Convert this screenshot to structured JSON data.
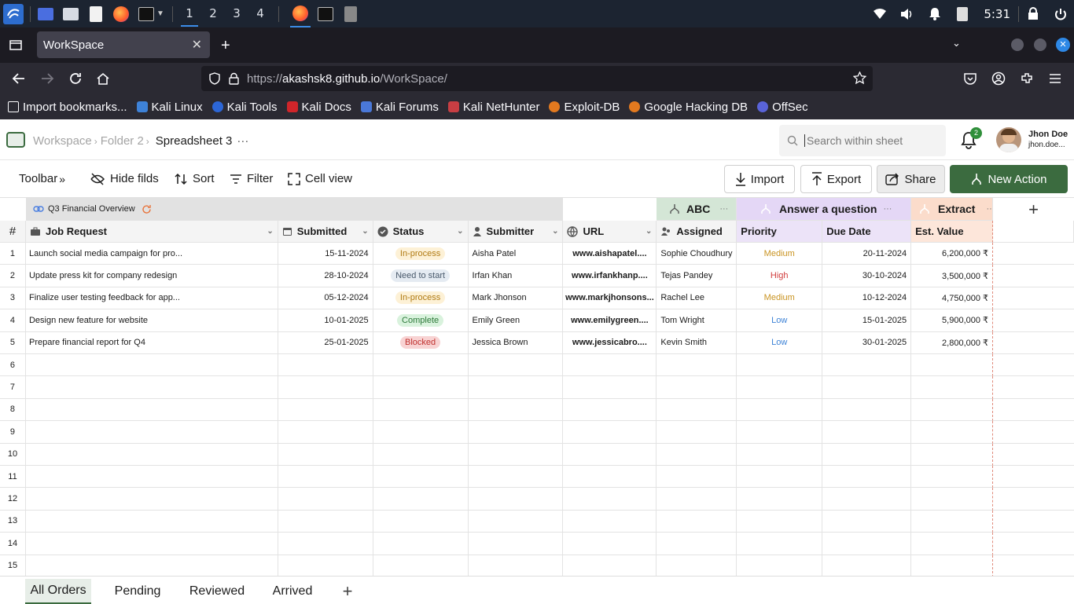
{
  "os": {
    "workspaces": [
      "1",
      "2",
      "3",
      "4"
    ],
    "clock": "5:31"
  },
  "browser": {
    "tab_title": "WorkSpace",
    "url_prefix": "https://",
    "url_host": "akashsk8.github.io",
    "url_path": "/WorkSpace/",
    "bookmarks": [
      "Import bookmarks...",
      "Kali Linux",
      "Kali Tools",
      "Kali Docs",
      "Kali Forums",
      "Kali NetHunter",
      "Exploit-DB",
      "Google Hacking DB",
      "OffSec"
    ]
  },
  "app": {
    "breadcrumb": {
      "root": "Workspace",
      "folder": "Folder 2",
      "sheet": "Spreadsheet 3",
      "more": "···"
    },
    "search_placeholder": "Search within sheet",
    "notifications": "2",
    "user": {
      "name": "Jhon Doe",
      "email": "jhon.doe..."
    }
  },
  "toolbar": {
    "toolbar": "Toolbar",
    "hide": "Hide filds",
    "sort": "Sort",
    "filter": "Filter",
    "cellview": "Cell view",
    "import": "Import",
    "export": "Export",
    "share": "Share",
    "new_action": "New Action"
  },
  "groups": {
    "overview": "Q3 Financial Overview",
    "abc": "ABC",
    "answer": "Answer a question",
    "extract": "Extract",
    "more": "···",
    "add": "+"
  },
  "columns": [
    "#",
    "Job Request",
    "Submitted",
    "Status",
    "Submitter",
    "URL",
    "Assigned",
    "Priority",
    "Due Date",
    "Est. Value"
  ],
  "rows": [
    {
      "n": "1",
      "job": "Launch social media campaign for pro...",
      "submitted": "15-11-2024",
      "status": "In-process",
      "submitter": "Aisha Patel",
      "url": "www.aishapatel....",
      "assigned": "Sophie Choudhury",
      "priority": "Medium",
      "due": "20-11-2024",
      "value": "6,200,000 ₹"
    },
    {
      "n": "2",
      "job": "Update press kit for company redesign",
      "submitted": "28-10-2024",
      "status": "Need to start",
      "submitter": "Irfan Khan",
      "url": "www.irfankhanp....",
      "assigned": "Tejas Pandey",
      "priority": "High",
      "due": "30-10-2024",
      "value": "3,500,000 ₹"
    },
    {
      "n": "3",
      "job": "Finalize user testing feedback for app...",
      "submitted": "05-12-2024",
      "status": "In-process",
      "submitter": "Mark Jhonson",
      "url": "www.markjhonsons...",
      "assigned": "Rachel Lee",
      "priority": "Medium",
      "due": "10-12-2024",
      "value": "4,750,000 ₹"
    },
    {
      "n": "4",
      "job": "Design new feature for website",
      "submitted": "10-01-2025",
      "status": "Complete",
      "submitter": "Emily Green",
      "url": "www.emilygreen....",
      "assigned": "Tom Wright",
      "priority": "Low",
      "due": "15-01-2025",
      "value": "5,900,000 ₹"
    },
    {
      "n": "5",
      "job": "Prepare financial report for Q4",
      "submitted": "25-01-2025",
      "status": "Blocked",
      "submitter": "Jessica Brown",
      "url": "www.jessicabro....",
      "assigned": "Kevin Smith",
      "priority": "Low",
      "due": "30-01-2025",
      "value": "2,800,000 ₹"
    }
  ],
  "empty_rows": [
    "6",
    "7",
    "8",
    "9",
    "10",
    "11",
    "12",
    "13",
    "14",
    "15"
  ],
  "status_colors": {
    "In-process": {
      "bg": "#fdf1d6",
      "fg": "#b07a12"
    },
    "Need to start": {
      "bg": "#e5ebf2",
      "fg": "#4a5a6c"
    },
    "Complete": {
      "bg": "#d9f2dd",
      "fg": "#2d7a3a"
    },
    "Blocked": {
      "bg": "#f8d3d3",
      "fg": "#c0312f"
    }
  },
  "priority_colors": {
    "Medium": "#c99320",
    "High": "#d13c3c",
    "Low": "#3c82d6"
  },
  "sheets": [
    "All Orders",
    "Pending",
    "Reviewed",
    "Arrived"
  ],
  "add_sheet": "+"
}
